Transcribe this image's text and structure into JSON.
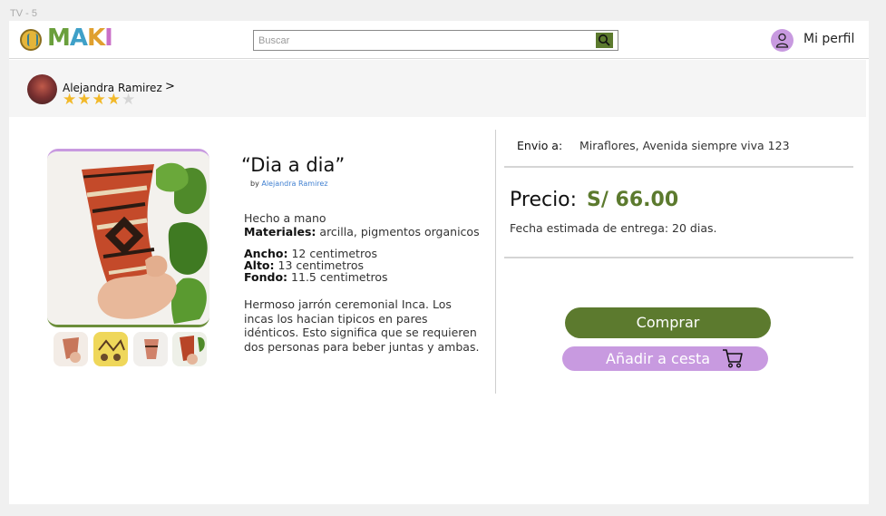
{
  "frame_label": "TV - 5",
  "header": {
    "logo": {
      "m": "M",
      "a": "A",
      "k": "K",
      "i": "I"
    },
    "search_placeholder": "Buscar",
    "profile_label": "Mi perfil"
  },
  "seller": {
    "name": "Alejandra Ramirez",
    "arrow": ">",
    "rating": 4,
    "rating_max": 5
  },
  "product": {
    "title": "“Dia a dia”",
    "by_prefix": "by",
    "by_name": "Alejandra Ramirez",
    "handmade": "Hecho a mano",
    "materials_label": "Materiales:",
    "materials_value": "arcilla, pigmentos organicos",
    "width_label": "Ancho:",
    "width_value": "12 centimetros",
    "height_label": "Alto:",
    "height_value": "13 centimetros",
    "depth_label": "Fondo:",
    "depth_value": "11.5 centimetros",
    "description": "Hermoso jarrón ceremonial Inca. Los incas los hacian tipicos en pares idénticos. Esto significa que se requieren dos personas para beber juntas y ambas."
  },
  "shipping": {
    "label": "Envio a:",
    "value": "Miraflores, Avenida siempre viva 123"
  },
  "pricing": {
    "label": "Precio:",
    "value": "S/ 66.00",
    "delivery": "Fecha estimada de entrega: 20 dias."
  },
  "actions": {
    "buy": "Comprar",
    "add_to_cart": "Añadir a cesta"
  },
  "colors": {
    "green": "#5c7a2e",
    "purple": "#c89ae0",
    "star": "#f2b92a"
  }
}
